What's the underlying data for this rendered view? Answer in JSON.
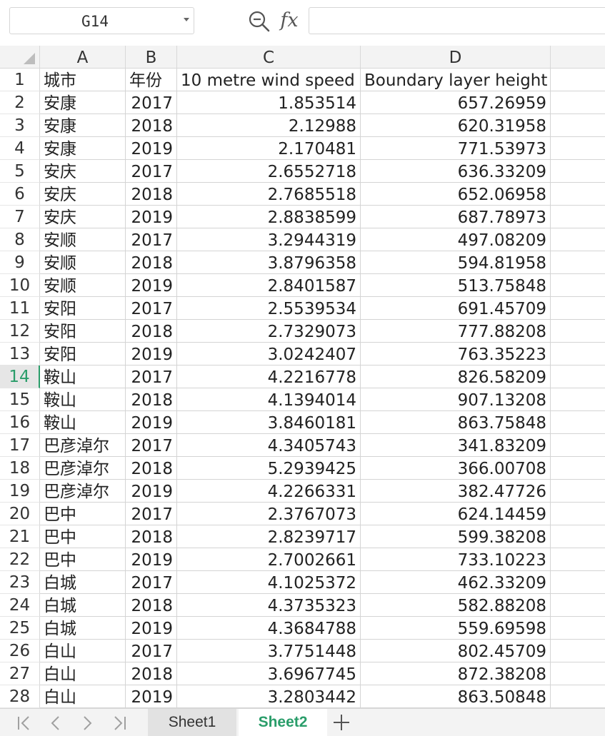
{
  "name_box": {
    "value": "G14"
  },
  "formula_bar": {
    "zoom_icon": "zoom-icon",
    "fx_label": "fx",
    "formula_value": ""
  },
  "columns": [
    "A",
    "B",
    "C",
    "D"
  ],
  "active_row": 14,
  "rows": [
    {
      "row": "1",
      "a": "城市",
      "b": "年份",
      "c": "10 metre wind speed",
      "d": "Boundary layer height"
    },
    {
      "row": "2",
      "a": "安康",
      "b": "2017",
      "c": "1.853514",
      "d": "657.26959"
    },
    {
      "row": "3",
      "a": "安康",
      "b": "2018",
      "c": "2.12988",
      "d": "620.31958"
    },
    {
      "row": "4",
      "a": "安康",
      "b": "2019",
      "c": "2.170481",
      "d": "771.53973"
    },
    {
      "row": "5",
      "a": "安庆",
      "b": "2017",
      "c": "2.6552718",
      "d": "636.33209"
    },
    {
      "row": "6",
      "a": "安庆",
      "b": "2018",
      "c": "2.7685518",
      "d": "652.06958"
    },
    {
      "row": "7",
      "a": "安庆",
      "b": "2019",
      "c": "2.8838599",
      "d": "687.78973"
    },
    {
      "row": "8",
      "a": "安顺",
      "b": "2017",
      "c": "3.2944319",
      "d": "497.08209"
    },
    {
      "row": "9",
      "a": "安顺",
      "b": "2018",
      "c": "3.8796358",
      "d": "594.81958"
    },
    {
      "row": "10",
      "a": "安顺",
      "b": "2019",
      "c": "2.8401587",
      "d": "513.75848"
    },
    {
      "row": "11",
      "a": "安阳",
      "b": "2017",
      "c": "2.5539534",
      "d": "691.45709"
    },
    {
      "row": "12",
      "a": "安阳",
      "b": "2018",
      "c": "2.7329073",
      "d": "777.88208"
    },
    {
      "row": "13",
      "a": "安阳",
      "b": "2019",
      "c": "3.0242407",
      "d": "763.35223"
    },
    {
      "row": "14",
      "a": "鞍山",
      "b": "2017",
      "c": "4.2216778",
      "d": "826.58209"
    },
    {
      "row": "15",
      "a": "鞍山",
      "b": "2018",
      "c": "4.1394014",
      "d": "907.13208"
    },
    {
      "row": "16",
      "a": "鞍山",
      "b": "2019",
      "c": "3.8460181",
      "d": "863.75848"
    },
    {
      "row": "17",
      "a": "巴彦淖尔",
      "b": "2017",
      "c": "4.3405743",
      "d": "341.83209"
    },
    {
      "row": "18",
      "a": "巴彦淖尔",
      "b": "2018",
      "c": "5.2939425",
      "d": "366.00708"
    },
    {
      "row": "19",
      "a": "巴彦淖尔",
      "b": "2019",
      "c": "4.2266331",
      "d": "382.47726"
    },
    {
      "row": "20",
      "a": "巴中",
      "b": "2017",
      "c": "2.3767073",
      "d": "624.14459"
    },
    {
      "row": "21",
      "a": "巴中",
      "b": "2018",
      "c": "2.8239717",
      "d": "599.38208"
    },
    {
      "row": "22",
      "a": "巴中",
      "b": "2019",
      "c": "2.7002661",
      "d": "733.10223"
    },
    {
      "row": "23",
      "a": "白城",
      "b": "2017",
      "c": "4.1025372",
      "d": "462.33209"
    },
    {
      "row": "24",
      "a": "白城",
      "b": "2018",
      "c": "4.3735323",
      "d": "582.88208"
    },
    {
      "row": "25",
      "a": "白城",
      "b": "2019",
      "c": "4.3684788",
      "d": "559.69598"
    },
    {
      "row": "26",
      "a": "白山",
      "b": "2017",
      "c": "3.7751448",
      "d": "802.45709"
    },
    {
      "row": "27",
      "a": "白山",
      "b": "2018",
      "c": "3.6967745",
      "d": "872.38208"
    },
    {
      "row": "28",
      "a": "白山",
      "b": "2019",
      "c": "3.2803442",
      "d": "863.50848"
    }
  ],
  "sheet_tabs": {
    "tabs": [
      "Sheet1",
      "Sheet2"
    ],
    "active": "Sheet2"
  },
  "colors": {
    "accent": "#2a9d6a",
    "grid_line": "#d4d4d4",
    "header_bg": "#f3f3f3"
  }
}
